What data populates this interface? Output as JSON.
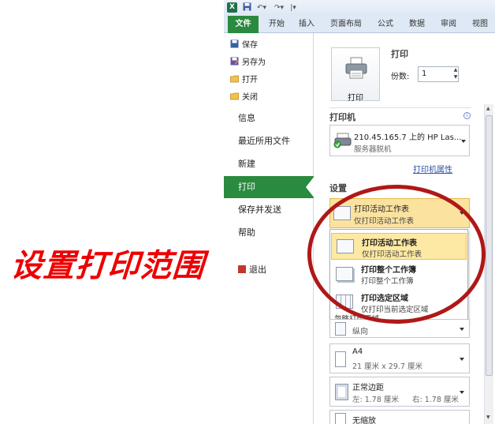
{
  "ribbon": {
    "tabs": [
      "文件",
      "开始",
      "插入",
      "页面布局",
      "公式",
      "数据",
      "审阅",
      "视图"
    ]
  },
  "nav": {
    "small_items": [
      "保存",
      "另存为",
      "打开",
      "关闭"
    ],
    "big_items": [
      "信息",
      "最近所用文件",
      "新建",
      "打印",
      "保存并发送",
      "帮助"
    ],
    "exit": "退出",
    "selected": "打印"
  },
  "print": {
    "section_title": "打印",
    "button_label": "打印",
    "copies_label": "份数:",
    "copies_value": "1"
  },
  "printer": {
    "section_title": "打印机",
    "name": "210.45.165.7 上的 HP Las...",
    "status": "服务器脱机",
    "properties_link": "打印机属性"
  },
  "settings": {
    "section_title": "设置",
    "selected": {
      "title": "打印活动工作表",
      "subtitle": "仅打印活动工作表"
    },
    "menu": [
      {
        "title": "打印活动工作表",
        "subtitle": "仅打印活动工作表"
      },
      {
        "title": "打印整个工作簿",
        "subtitle": "打印整个工作簿"
      },
      {
        "title": "打印选定区域",
        "subtitle": "仅打印当前选定区域"
      }
    ],
    "ignore_print_area": "忽略打印区域",
    "orientation": "纵向",
    "paper": {
      "title": "A4",
      "subtitle": "21 厘米 x 29.7 厘米"
    },
    "margins": {
      "title": "正常边距",
      "left": "左: 1.78 厘米",
      "right": "右: 1.78 厘米"
    },
    "scaling": "无缩放"
  },
  "annotation": {
    "text": "设置打印范围",
    "color": "#ee0000",
    "ellipse_color": "#b01818"
  },
  "colors": {
    "accent": "#2a8a3e",
    "highlight": "#fbe39f"
  }
}
